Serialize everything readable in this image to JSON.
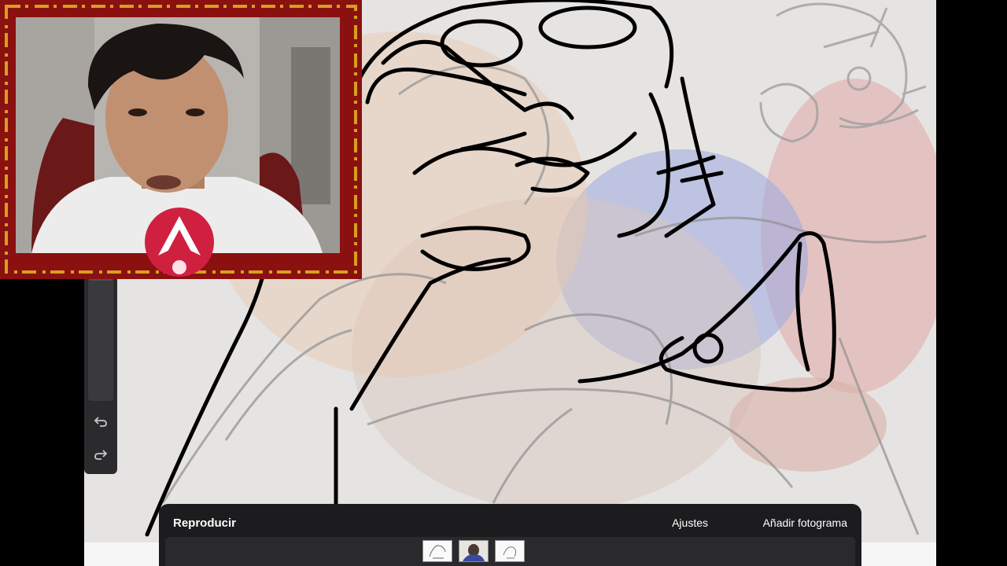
{
  "toolbar": {
    "undo_icon": "undo-arrow-icon",
    "redo_icon": "redo-arrow-icon"
  },
  "animation_bar": {
    "play_label": "Reproducir",
    "settings_label": "Ajustes",
    "add_frame_label": "Añadir fotograma",
    "frames": [
      {
        "name": "frame-1",
        "icon": "sketch-thumbnail"
      },
      {
        "name": "frame-2",
        "icon": "photo-thumbnail",
        "selected": true
      },
      {
        "name": "frame-3",
        "icon": "sketch-thumbnail"
      }
    ]
  },
  "colors": {
    "background": "#000000",
    "toolbar": "#2b2b2d",
    "anim_bar": "#1c1c1e",
    "webcam_frame": "#8b1010",
    "webcam_frame_accent": "#d4a020",
    "logo": "#d02040"
  }
}
